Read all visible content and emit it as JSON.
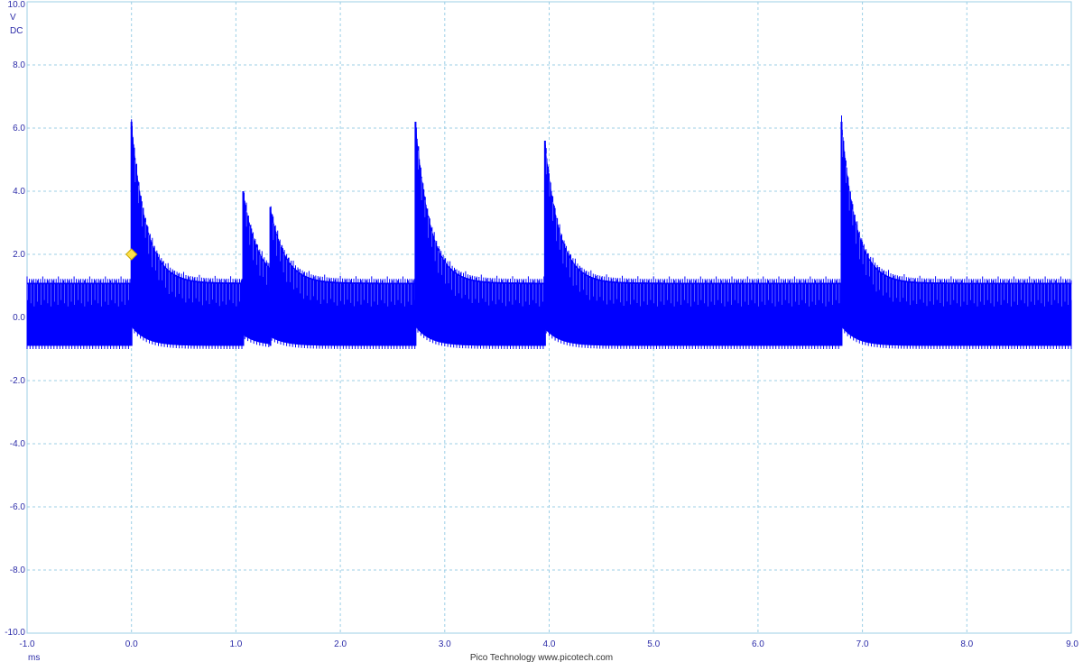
{
  "chart_data": {
    "type": "line",
    "y_unit": "V",
    "coupling": "DC",
    "x_unit": "ms",
    "footer": "Pico Technology  www.picotech.com",
    "xlim": [
      -1.0,
      9.0
    ],
    "ylim": [
      -10.0,
      10.0
    ],
    "x_ticks": [
      "-1.0",
      "0.0",
      "1.0",
      "2.0",
      "3.0",
      "4.0",
      "5.0",
      "6.0",
      "7.0",
      "8.0",
      "9.0"
    ],
    "y_ticks": [
      "10.0",
      "8.0",
      "6.0",
      "4.0",
      "2.0",
      "0.0",
      "-2.0",
      "-4.0",
      "-6.0",
      "-8.0",
      "-10.0"
    ],
    "grid": true,
    "trace_color": "#0000ff",
    "baseline_band_v": [
      -0.9,
      1.1
    ],
    "trigger": {
      "x": 0.0,
      "y": 2.0,
      "color": "#ffe14d"
    },
    "series": [
      {
        "spikes": [
          {
            "x": 0.0,
            "y": 6.2
          },
          {
            "x": 1.07,
            "y": 4.0
          },
          {
            "x": 1.33,
            "y": 3.5
          },
          {
            "x": 2.72,
            "y": 6.2
          },
          {
            "x": 3.96,
            "y": 5.6
          },
          {
            "x": 6.8,
            "y": 6.2
          }
        ]
      }
    ]
  }
}
